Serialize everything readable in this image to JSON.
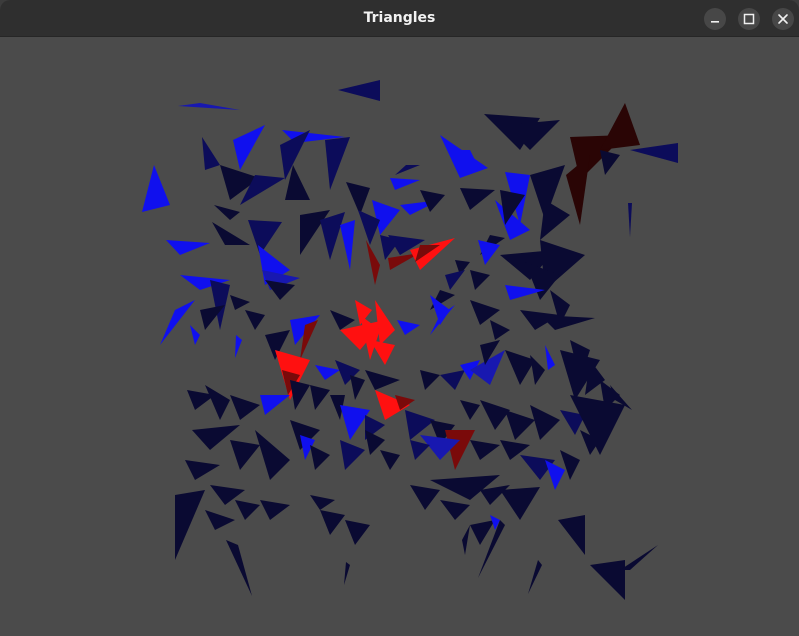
{
  "window": {
    "title": "Triangles",
    "controls": {
      "minimize": "minimize-icon",
      "maximize": "maximize-icon",
      "close": "close-icon"
    }
  },
  "canvas": {
    "background": "#4b4b4b",
    "palette": {
      "dark_navy": "#0a0a32",
      "navy": "#0c0c5a",
      "blue": "#1010ee",
      "mid_blue": "#1818b0",
      "red": "#ff1010",
      "dark_red": "#7a0a0a",
      "maroon": "#2a0505"
    }
  }
}
